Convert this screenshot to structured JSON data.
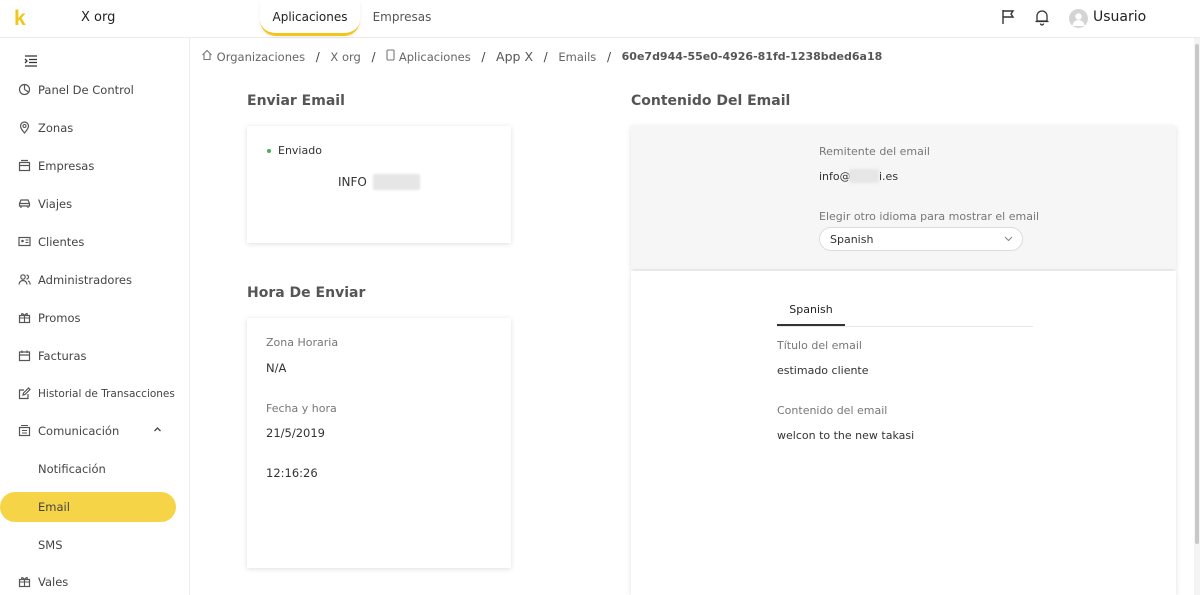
{
  "topbar": {
    "logo": "k",
    "org_name": "X org",
    "tabs": [
      "Aplicaciones",
      "Empresas"
    ],
    "user_name": "Usuario"
  },
  "sidebar": {
    "items": [
      {
        "label": "Panel De Control",
        "icon": "dashboard-icon"
      },
      {
        "label": "Zonas",
        "icon": "location-pin-icon"
      },
      {
        "label": "Empresas",
        "icon": "building-icon"
      },
      {
        "label": "Viajes",
        "icon": "car-icon"
      },
      {
        "label": "Clientes",
        "icon": "id-card-icon"
      },
      {
        "label": "Administradores",
        "icon": "admins-icon"
      },
      {
        "label": "Promos",
        "icon": "gift-icon"
      },
      {
        "label": "Facturas",
        "icon": "invoice-icon"
      },
      {
        "label": "Historial de Transacciones",
        "icon": "edit-icon"
      },
      {
        "label": "Comunicación",
        "icon": "communication-icon"
      },
      {
        "label": "Notificación",
        "icon": ""
      },
      {
        "label": "Email",
        "icon": ""
      },
      {
        "label": "SMS",
        "icon": ""
      },
      {
        "label": "Vales",
        "icon": "voucher-icon"
      }
    ],
    "active": "Email"
  },
  "breadcrumb": {
    "items": [
      "Organizaciones",
      "X org",
      "Aplicaciones",
      "App X",
      "Emails",
      "60e7d944-55e0-4926-81fd-1238bded6a18"
    ]
  },
  "send_email": {
    "title": "Enviar Email",
    "status": "Enviado",
    "sender_name": "INFO"
  },
  "send_time": {
    "title": "Hora De Enviar",
    "timezone_label": "Zona Horaria",
    "timezone_value": "N/A",
    "datetime_label": "Fecha y hora",
    "date_value": "21/5/2019",
    "time_value": "12:16:26"
  },
  "email_content": {
    "title": "Contenido Del Email",
    "sender_label": "Remitente del email",
    "sender_prefix": "info@",
    "sender_suffix": "i.es",
    "language_label": "Elegir otro idioma para mostrar el email",
    "language_selected": "Spanish",
    "language_tab": "Spanish",
    "subject_label": "Título del email",
    "subject_value": "estimado cliente",
    "body_label": "Contenido del email",
    "body_value": "welcon to the new takasi"
  },
  "colors": {
    "accent": "#f2c51b",
    "active_pill": "#f5d547",
    "status_ok": "#4caf50"
  }
}
